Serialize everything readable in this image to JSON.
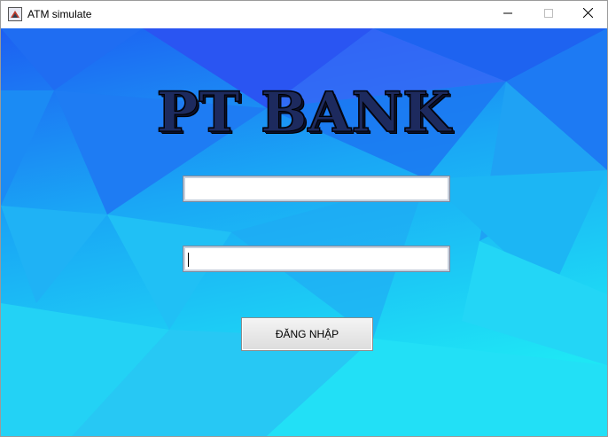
{
  "window": {
    "title": "ATM simulate",
    "icon": "java-app-icon",
    "controls": [
      "minimize-icon",
      "maximize-icon",
      "close-icon"
    ]
  },
  "login": {
    "bank_name": "PT BANK",
    "username_value": "",
    "password_value": "",
    "login_label": "ĐĂNG NHẬP"
  },
  "colors": {
    "background_top": "#1a5ef0",
    "background_bottom": "#1ee6f5",
    "title_color": "#1d2a5e"
  }
}
